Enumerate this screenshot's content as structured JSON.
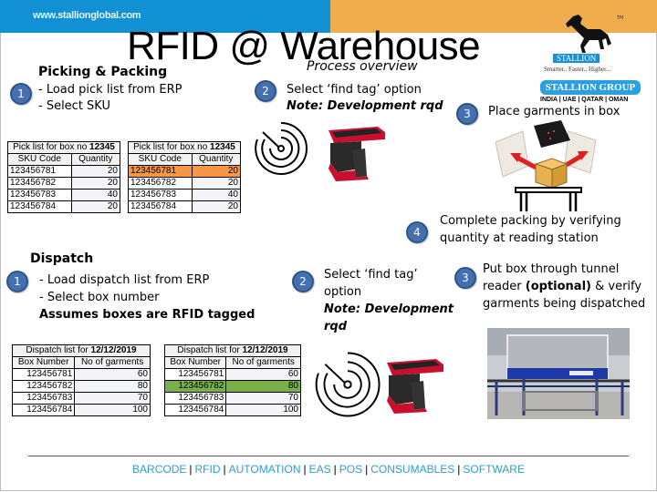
{
  "header": {
    "url": "www.stallionglobal.com",
    "colors": {
      "blue": "#1191d3",
      "orange": "#f0ad4e"
    }
  },
  "title": "RFID @ Warehouse",
  "subtitle": "Process overview",
  "logo": {
    "tm": "TM",
    "brand": "STALLION",
    "slogan": "Smarter.. Faster.. Higher...",
    "group": "STALLION GROUP",
    "countries": "INDIA | UAE | QATAR | OMAN"
  },
  "picking": {
    "heading": "Picking & Packing",
    "step1": {
      "number": "1",
      "lines": [
        "- Load pick list from ERP",
        "- Select SKU"
      ]
    },
    "step2": {
      "number": "2",
      "line": "Select ‘find tag’ option",
      "note": "Note: Development rqd"
    },
    "step3": {
      "number": "3",
      "line": "Place garments in box"
    },
    "step4": {
      "number": "4",
      "lines": [
        "Complete packing by verifying",
        "quantity at reading station"
      ]
    },
    "table_title_prefix": "Pick list for box no ",
    "table_title_box": "12345",
    "columns": [
      "SKU Code",
      "Quantity"
    ],
    "rows": [
      {
        "sku": "123456781",
        "qty": "20"
      },
      {
        "sku": "123456782",
        "qty": "20"
      },
      {
        "sku": "123456783",
        "qty": "40"
      },
      {
        "sku": "123456784",
        "qty": "20"
      }
    ],
    "highlight_color": "#f79646"
  },
  "dispatch": {
    "heading": "Dispatch",
    "step1": {
      "number": "1",
      "lines": [
        "- Load dispatch list from ERP",
        "- Select box number"
      ],
      "note": "Assumes boxes are RFID tagged"
    },
    "step2": {
      "number": "2",
      "lines": [
        "Select ‘find tag’",
        "option"
      ],
      "note": [
        "Note: Development",
        "rqd"
      ]
    },
    "step3": {
      "number": "3",
      "line1": "Put box through tunnel",
      "line2_prefix": "reader ",
      "line2_bold": "(optional)",
      "line2_suffix": " & verify",
      "line3": "garments being dispatched"
    },
    "table_title_prefix": "Dispatch list for ",
    "table_title_date": "12/12/2019",
    "columns": [
      "Box Number",
      "No of garments"
    ],
    "rows": [
      {
        "box": "123456781",
        "count": "60"
      },
      {
        "box": "123456782",
        "count": "80"
      },
      {
        "box": "123456783",
        "count": "70"
      },
      {
        "box": "123456784",
        "count": "100"
      }
    ],
    "highlight_color": "#77b04a"
  },
  "footer": {
    "items": [
      "BARCODE",
      "RFID",
      "AUTOMATION",
      "EAS",
      "POS",
      "CONSUMABLES",
      "SOFTWARE"
    ],
    "separator": "|"
  }
}
